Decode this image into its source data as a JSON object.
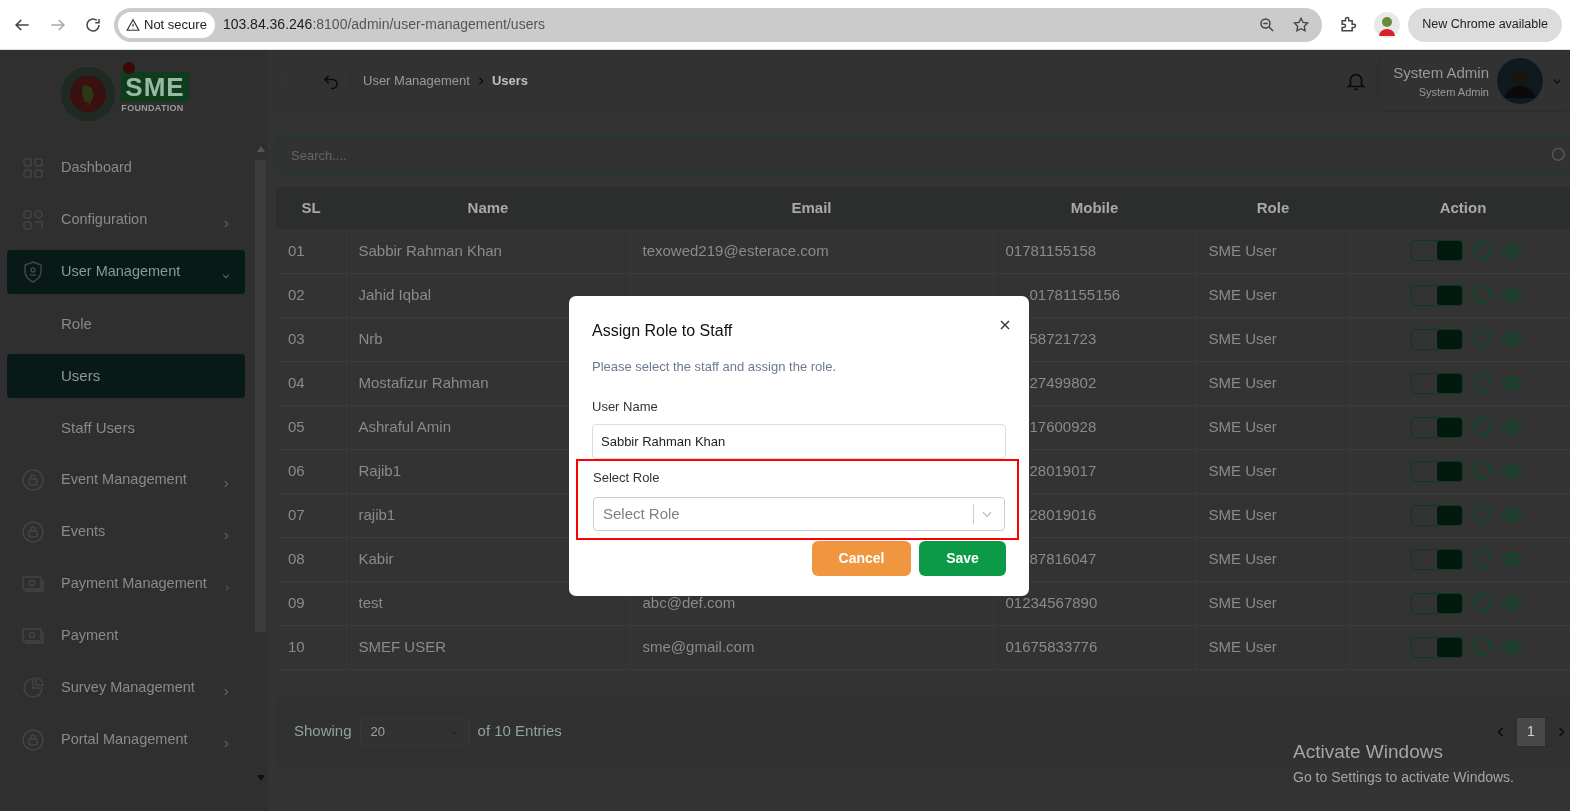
{
  "browser": {
    "security": "Not secure",
    "url_host": "103.84.36.246",
    "url_rest": ":8100/admin/user-management/users",
    "update": "New Chrome available"
  },
  "logo": {
    "word": "SME",
    "tagline": "FOUNDATION"
  },
  "sidebar": {
    "items": [
      {
        "label": "Dashboard",
        "selected": false
      },
      {
        "label": "Configuration",
        "selected": false,
        "expanded": false
      },
      {
        "label": "User Management",
        "selected": true,
        "expanded": true,
        "children": [
          {
            "label": "Role",
            "selected": false
          },
          {
            "label": "Users",
            "selected": true
          },
          {
            "label": "Staff Users",
            "selected": false
          }
        ]
      },
      {
        "label": "Event Management",
        "selected": false,
        "expanded": false
      },
      {
        "label": "Events",
        "selected": false,
        "expanded": false
      },
      {
        "label": "Payment Management",
        "selected": false,
        "expanded": false
      },
      {
        "label": "Payment",
        "selected": false
      },
      {
        "label": "Survey Management",
        "selected": false,
        "expanded": false
      },
      {
        "label": "Portal Management",
        "selected": false,
        "expanded": false
      }
    ]
  },
  "header": {
    "breadcrumb": [
      {
        "label": "User Management",
        "current": false
      },
      {
        "label": "Users",
        "current": true
      }
    ],
    "user": {
      "name": "System Admin",
      "role": "System Admin"
    }
  },
  "search": {
    "placeholder": "Search...."
  },
  "table": {
    "columns": [
      "SL",
      "Name",
      "Email",
      "Mobile",
      "Role",
      "Action"
    ],
    "rows": [
      {
        "sl": "01",
        "name": "Sabbir Rahman Khan",
        "email": "texowed219@esterace.com",
        "mobile": "01781155158",
        "role": "SME User",
        "active": true
      },
      {
        "sl": "02",
        "name": "Jahid Iqbal",
        "mobile": "01781155156",
        "role": "SME User",
        "active": true
      },
      {
        "sl": "03",
        "name": "Nrb",
        "mobile": "58721723",
        "role": "SME User",
        "active": true
      },
      {
        "sl": "04",
        "name": "Mostafizur Rahman",
        "mobile": "27499802",
        "role": "SME User",
        "active": true
      },
      {
        "sl": "05",
        "name": "Ashraful Amin",
        "mobile": "17600928",
        "role": "SME User",
        "active": true
      },
      {
        "sl": "06",
        "name": "Rajib1",
        "mobile": "28019017",
        "role": "SME User",
        "active": true
      },
      {
        "sl": "07",
        "name": "rajib1",
        "mobile": "28019016",
        "role": "SME User",
        "active": true
      },
      {
        "sl": "08",
        "name": "Kabir",
        "mobile": "87816047",
        "role": "SME User",
        "active": true
      },
      {
        "sl": "09",
        "name": "test",
        "email": "abc@def.com",
        "mobile": "01234567890",
        "role": "SME User",
        "active": true
      },
      {
        "sl": "10",
        "name": "SMEF USER",
        "email": "sme@gmail.com",
        "mobile": "01675833776",
        "role": "SME User",
        "active": true
      }
    ]
  },
  "pagination": {
    "label": "Showing",
    "page_size": "20",
    "suffix": "of 10 Entries",
    "pages": [
      {
        "label": "1",
        "selected": true
      }
    ]
  },
  "modal": {
    "title": "Assign Role to Staff",
    "description": "Please select the staff and assign the role.",
    "user_label": "User Name",
    "user_value": "Sabbir Rahman Khan",
    "role_label": "Select Role",
    "role_placeholder": "Select Role",
    "highlighted": true,
    "cancel": "Cancel",
    "save": "Save"
  },
  "os_notice": {
    "title": "Activate Windows",
    "text": "Go to Settings to activate Windows."
  }
}
